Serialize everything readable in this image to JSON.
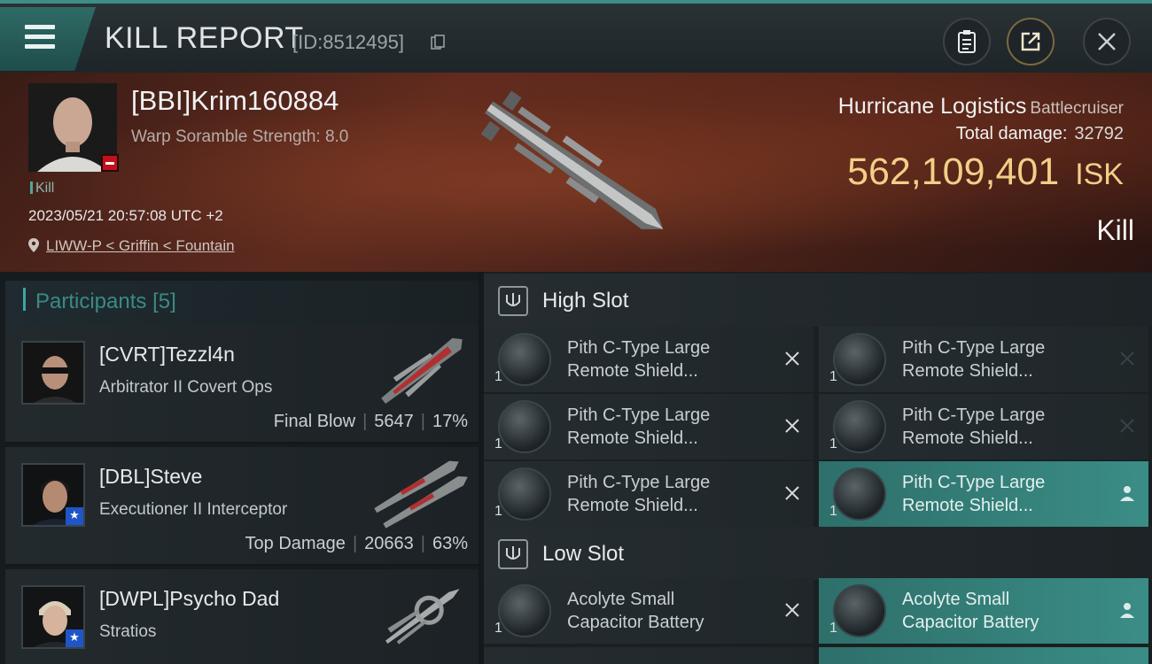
{
  "header": {
    "title": "KILL REPORT",
    "report_id": "[ID:8512495]"
  },
  "victim": {
    "name": "[BBI]Krim160884",
    "warp_scramble": "Warp Soramble Strength: 8.0",
    "kill_tag": "Kill",
    "datetime": "2023/05/21 20:57:08 UTC +2",
    "location": "LIWW-P < Griffin < Fountain",
    "ship_name": "Hurricane Logistics",
    "ship_class": "Battlecruiser",
    "total_damage_label": "Total damage:",
    "total_damage": "32792",
    "isk_value": "562,109,401",
    "isk_unit": "ISK",
    "result": "Kill"
  },
  "participants": {
    "label": "Participants",
    "count": "[5]",
    "rows": [
      {
        "name": "[CVRT]Tezzl4n",
        "ship": "Arbitrator II Covert Ops",
        "role": "Final Blow",
        "damage": "5647",
        "percent": "17%"
      },
      {
        "name": "[DBL]Steve",
        "ship": "Executioner II Interceptor",
        "role": "Top Damage",
        "damage": "20663",
        "percent": "63%"
      },
      {
        "name": "[DWPL]Psycho Dad",
        "ship": "Stratios",
        "role": "",
        "damage": "",
        "percent": ""
      }
    ]
  },
  "slots": {
    "high": {
      "title": "High Slot",
      "items": [
        {
          "qty": "1",
          "line1": "Pith C-Type Large",
          "line2": "Remote Shield...",
          "status": "destroyed"
        },
        {
          "qty": "1",
          "line1": "Pith C-Type Large",
          "line2": "Remote Shield...",
          "status": "destroyed"
        },
        {
          "qty": "1",
          "line1": "Pith C-Type Large",
          "line2": "Remote Shield...",
          "status": "destroyed"
        },
        {
          "qty": "1",
          "line1": "Pith C-Type Large",
          "line2": "Remote Shield...",
          "status": "destroyed"
        },
        {
          "qty": "1",
          "line1": "Pith C-Type Large",
          "line2": "Remote Shield...",
          "status": "destroyed"
        },
        {
          "qty": "1",
          "line1": "Pith C-Type Large",
          "line2": "Remote Shield...",
          "status": "dropped"
        }
      ]
    },
    "low": {
      "title": "Low Slot",
      "items": [
        {
          "qty": "1",
          "line1": "Acolyte Small",
          "line2": "Capacitor Battery",
          "status": "destroyed"
        },
        {
          "qty": "1",
          "line1": "Acolyte Small",
          "line2": "Capacitor Battery",
          "status": "dropped"
        }
      ]
    }
  },
  "colors": {
    "accent_teal": "#3fa6a0",
    "isk_gold": "#f2cf87",
    "dropped_bg": "#3a8d86",
    "security_red": "#c0121d"
  },
  "icons": {
    "menu": "hamburger-icon",
    "copy": "copy-icon",
    "clipboard": "clipboard-icon",
    "share": "share-icon",
    "close": "close-icon",
    "location": "location-pin-icon",
    "slot": "slot-icon",
    "destroyed": "x-icon",
    "dropped": "person-icon"
  }
}
